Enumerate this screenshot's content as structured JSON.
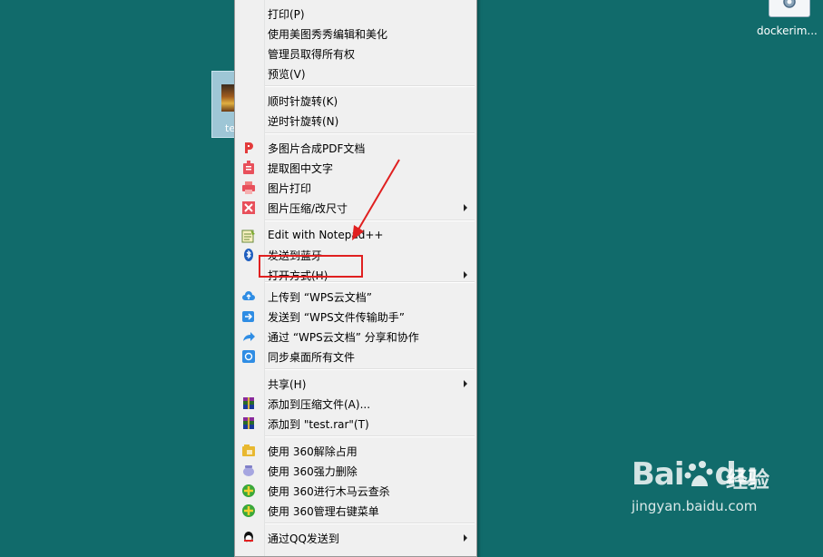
{
  "desktop": {
    "file_label_partial": "te",
    "docker_label": "dockerim..."
  },
  "menu": {
    "items": [
      {
        "label": "打印(P)",
        "icon": "none",
        "submenu": false
      },
      {
        "label": "使用美图秀秀编辑和美化",
        "icon": "none",
        "submenu": false
      },
      {
        "label": "管理员取得所有权",
        "icon": "none",
        "submenu": false
      },
      {
        "label": "预览(V)",
        "icon": "none",
        "submenu": false
      },
      {
        "label": "顺时针旋转(K)",
        "icon": "none",
        "submenu": false
      },
      {
        "label": "逆时针旋转(N)",
        "icon": "none",
        "submenu": false
      },
      {
        "label": "多图片合成PDF文档",
        "icon": "wps-pdf-icon",
        "submenu": false
      },
      {
        "label": "提取图中文字",
        "icon": "wps-ocr-icon",
        "submenu": false
      },
      {
        "label": "图片打印",
        "icon": "wps-print-icon",
        "submenu": false
      },
      {
        "label": "图片压缩/改尺寸",
        "icon": "wps-compress-icon",
        "submenu": true
      },
      {
        "label": "Edit with Notepad++",
        "icon": "notepad-icon",
        "submenu": false
      },
      {
        "label": "发送到蓝牙",
        "icon": "bluetooth-icon",
        "submenu": false
      },
      {
        "label": "打开方式(H)",
        "icon": "none",
        "submenu": true
      },
      {
        "label": "上传到 “WPS云文档”",
        "icon": "cloud-upload-icon",
        "submenu": false
      },
      {
        "label": "发送到 “WPS文件传输助手”",
        "icon": "send-arrow-icon",
        "submenu": false
      },
      {
        "label": "通过 “WPS云文档” 分享和协作",
        "icon": "share-icon",
        "submenu": false
      },
      {
        "label": "同步桌面所有文件",
        "icon": "sync-icon",
        "submenu": false
      },
      {
        "label": "共享(H)",
        "icon": "none",
        "submenu": true
      },
      {
        "label": "添加到压缩文件(A)...",
        "icon": "winrar-icon",
        "submenu": false
      },
      {
        "label": "添加到 \"test.rar\"(T)",
        "icon": "winrar-icon",
        "submenu": false
      },
      {
        "label": "使用 360解除占用",
        "icon": "unlock-360-icon",
        "submenu": false
      },
      {
        "label": "使用 360强力删除",
        "icon": "delete-360-icon",
        "submenu": false
      },
      {
        "label": "使用 360进行木马云查杀",
        "icon": "scan-360-icon",
        "submenu": false
      },
      {
        "label": "使用 360管理右键菜单",
        "icon": "menu-360-icon",
        "submenu": false
      },
      {
        "label": "通过QQ发送到",
        "icon": "qq-icon",
        "submenu": true
      }
    ]
  },
  "watermark": {
    "brand_latin": "Bai",
    "brand_latin_tail": "du",
    "brand_cn": "经验",
    "url": "jingyan.baidu.com"
  },
  "colors": {
    "desktop_bg": "#116b6b",
    "menu_bg": "#f0f0f0",
    "highlight": "#e02020"
  }
}
